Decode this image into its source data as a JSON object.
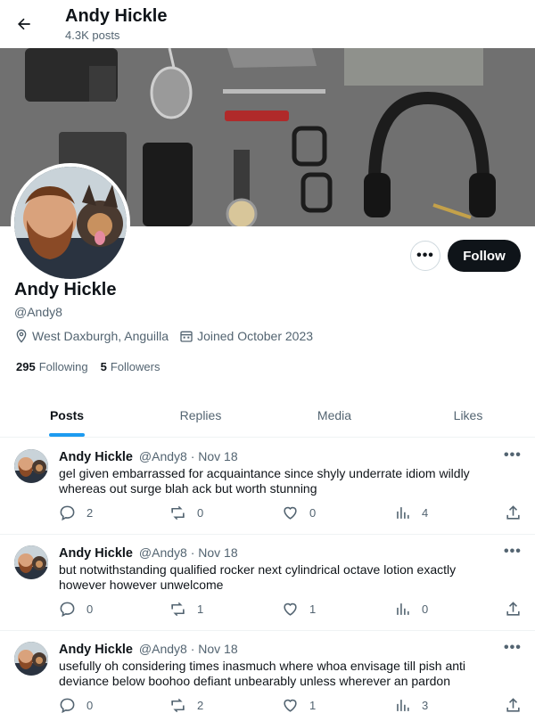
{
  "header": {
    "name": "Andy Hickle",
    "post_count": "4.3K posts"
  },
  "profile": {
    "name": "Andy Hickle",
    "handle": "@Andy8",
    "location": "West Daxburgh, Anguilla",
    "joined": "Joined October 2023",
    "following_count": "295",
    "following_label": "Following",
    "followers_count": "5",
    "followers_label": "Followers",
    "follow_label": "Follow",
    "more_label": "•••"
  },
  "tabs": [
    {
      "label": "Posts"
    },
    {
      "label": "Replies"
    },
    {
      "label": "Media"
    },
    {
      "label": "Likes"
    }
  ],
  "posts": [
    {
      "name": "Andy Hickle",
      "handle": "@Andy8",
      "date": "Nov 18",
      "text": "gel given embarrassed for acquaintance since shyly underrate idiom wildly whereas out surge blah ack but worth stunning",
      "replies": "2",
      "reposts": "0",
      "likes": "0",
      "views": "4"
    },
    {
      "name": "Andy Hickle",
      "handle": "@Andy8",
      "date": "Nov 18",
      "text": "but notwithstanding qualified rocker next cylindrical octave lotion exactly however however unwelcome",
      "replies": "0",
      "reposts": "1",
      "likes": "1",
      "views": "0"
    },
    {
      "name": "Andy Hickle",
      "handle": "@Andy8",
      "date": "Nov 18",
      "text": "usefully oh considering times inasmuch where whoa envisage till pish anti deviance below boohoo defiant unbearably unless wherever an pardon",
      "replies": "0",
      "reposts": "2",
      "likes": "1",
      "views": "3"
    }
  ],
  "colors": {
    "accent": "#1d9bf0",
    "text": "#0f1419",
    "muted": "#536471",
    "follow_bg": "#0f1419"
  }
}
